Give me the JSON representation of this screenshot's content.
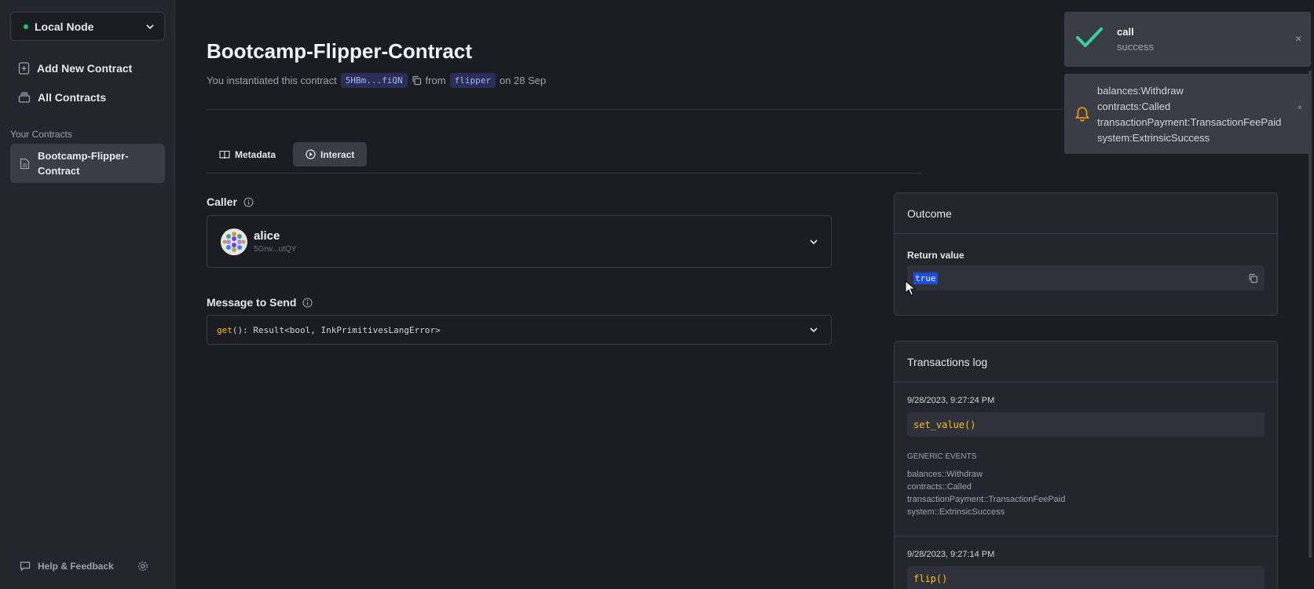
{
  "sidebar": {
    "node": "Local Node",
    "add_contract": "Add New Contract",
    "all_contracts": "All Contracts",
    "section": "Your Contracts",
    "contract_line1": "Bootcamp-Flipper-",
    "contract_line2": "Contract",
    "help": "Help & Feedback"
  },
  "header": {
    "title": "Bootcamp-Flipper-Contract",
    "sub_prefix": "You instantiated this contract",
    "address": "5HBm...fiQN",
    "from": "from",
    "code": "flipper",
    "date": "on 28 Sep"
  },
  "tabs": {
    "metadata": "Metadata",
    "interact": "Interact"
  },
  "caller": {
    "label": "Caller",
    "name": "alice",
    "address": "5Grw...utQY"
  },
  "message": {
    "label": "Message to Send",
    "fn": "get",
    "signature": "(): Result<bool, InkPrimitivesLangError>"
  },
  "outcome": {
    "title": "Outcome",
    "return_label": "Return value",
    "return_value": "true"
  },
  "txlog": {
    "title": "Transactions log",
    "entries": [
      {
        "time": "9/28/2023, 9:27:24 PM",
        "call": "set_value()",
        "events_title": "GENERIC EVENTS",
        "events": [
          "balances::Withdraw",
          "contracts::Called",
          "transactionPayment::TransactionFeePaid",
          "system::ExtrinsicSuccess"
        ]
      },
      {
        "time": "9/28/2023, 9:27:14 PM",
        "call": "flip()"
      }
    ]
  },
  "toasts": {
    "call_title": "call",
    "call_sub": "success",
    "events": [
      "balances:Withdraw",
      "contracts:Called",
      "transactionPayment:TransactionFeePaid",
      "system:ExtrinsicSuccess"
    ],
    "close": "×"
  },
  "colors": {
    "accent_green": "#22c55e",
    "fn_yellow": "#fbbf24",
    "chip_text": "#a5b4fc"
  }
}
